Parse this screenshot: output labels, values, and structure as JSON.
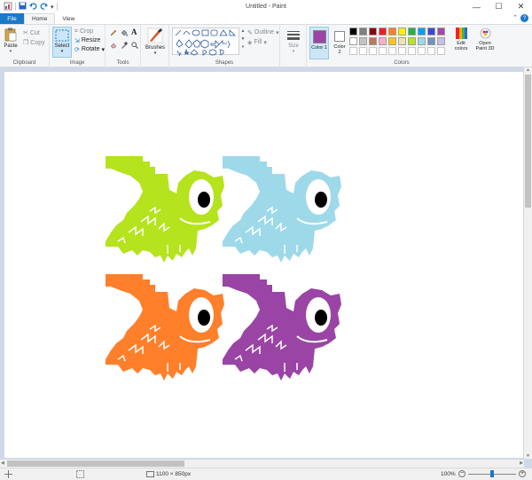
{
  "window": {
    "title": "Untitled - Paint"
  },
  "tabs": [
    {
      "label": "File"
    },
    {
      "label": "Home"
    },
    {
      "label": "View"
    }
  ],
  "ribbon": {
    "clipboard": {
      "paste": "Paste",
      "cut": "Cut",
      "copy": "Copy",
      "label": "Clipboard"
    },
    "image": {
      "select": "Select",
      "crop": "Crop",
      "resize": "Resize",
      "rotate": "Rotate",
      "label": "Image"
    },
    "tools": {
      "text_glyph": "A",
      "label": "Tools"
    },
    "brushes": {
      "label": "Brushes"
    },
    "shapes": {
      "outline": "Outline",
      "fill": "Fill",
      "label": "Shapes"
    },
    "size": {
      "label": "Size"
    },
    "colors": {
      "color1": "Color 1",
      "color2": "Color 2",
      "edit": "Edit colors",
      "paint3d": "Open Paint 3D",
      "label": "Colors",
      "color1_value": "#9b44a4",
      "color2_value": "#ffffff",
      "palette_row1": [
        "#000000",
        "#7f7f7f",
        "#880015",
        "#ed1c24",
        "#ff7f27",
        "#fff200",
        "#22b14c",
        "#00a2e8",
        "#3f48cc",
        "#a349a4"
      ],
      "palette_row2": [
        "#ffffff",
        "#c3c3c3",
        "#b97a57",
        "#ffaec9",
        "#ffc90e",
        "#efe4b0",
        "#b5e61d",
        "#99d9ea",
        "#7092be",
        "#c8bfe7"
      ],
      "palette_row3": [
        "#ffffff",
        "#ffffff",
        "#ffffff",
        "#ffffff",
        "#ffffff",
        "#ffffff",
        "#ffffff",
        "#ffffff",
        "#ffffff",
        "#ffffff"
      ]
    }
  },
  "canvas": {
    "fish": [
      {
        "color": "#b5e31d"
      },
      {
        "color": "#9ed9ea"
      },
      {
        "color": "#ff7f2a"
      },
      {
        "color": "#9a44a5"
      }
    ]
  },
  "status": {
    "size": "1100 × 850px",
    "zoom": "100%"
  }
}
